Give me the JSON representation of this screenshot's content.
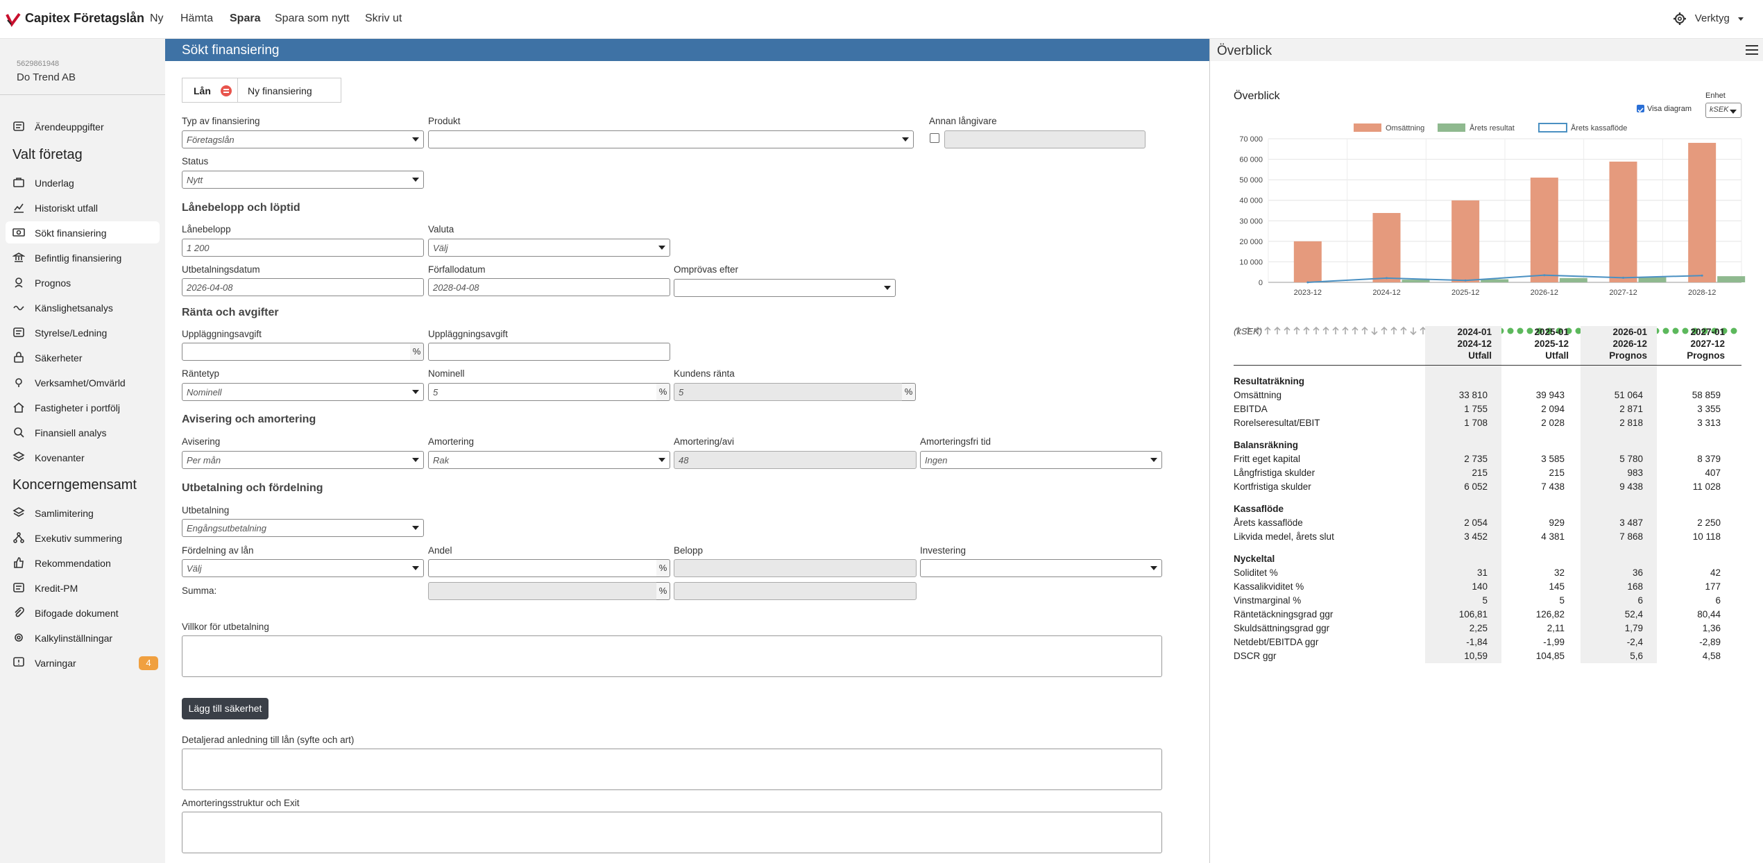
{
  "topbar": {
    "brand": "Capitex Företagslån",
    "nav": [
      "Ny",
      "Hämta",
      "Spara",
      "Spara som nytt",
      "Skriv ut"
    ],
    "tools": "Verktyg"
  },
  "sidebar": {
    "orgnr": "5629861948",
    "company": "Do Trend AB",
    "top_item": "Ärendeuppgifter",
    "section1": "Valt företag",
    "section1_items": [
      "Underlag",
      "Historiskt utfall",
      "Sökt finansiering",
      "Befintlig finansiering",
      "Prognos",
      "Känslighetsanalys",
      "Styrelse/Ledning",
      "Säkerheter",
      "Verksamhet/Omvärld",
      "Fastigheter i portfölj",
      "Finansiell analys",
      "Kovenanter"
    ],
    "section2": "Koncerngemensamt",
    "section2_items": [
      "Samlimitering",
      "Exekutiv summering",
      "Rekommendation",
      "Kredit-PM",
      "Bifogade dokument",
      "Kalkylinställningar",
      "Varningar"
    ],
    "warnings_count": "4"
  },
  "main": {
    "title": "Sökt finansiering",
    "tabs": [
      "Lån",
      "Ny finansiering"
    ],
    "labels": {
      "typ": "Typ av finansiering",
      "produkt": "Produkt",
      "annan": "Annan långivare",
      "status": "Status",
      "sec_belopp": "Lånebelopp och löptid",
      "lanebelopp": "Lånebelopp",
      "valuta": "Valuta",
      "utbetalningsdatum": "Utbetalningsdatum",
      "forfallodatum": "Förfallodatum",
      "omprovas": "Omprövas efter",
      "sec_ranta": "Ränta och avgifter",
      "upplagg1": "Uppläggningsavgift",
      "upplagg2": "Uppläggningsavgift",
      "rantetyp": "Räntetyp",
      "nominell": "Nominell",
      "kundens": "Kundens ränta",
      "sec_avisering": "Avisering och amortering",
      "avisering": "Avisering",
      "amortering": "Amortering",
      "amort_avi": "Amortering/avi",
      "amortfri": "Amorteringsfri tid",
      "sec_utbet": "Utbetalning och fördelning",
      "utbetalning": "Utbetalning",
      "fordelning": "Fördelning av lån",
      "andel": "Andel",
      "belopp": "Belopp",
      "investering": "Investering",
      "summa": "Summa:",
      "villkor": "Villkor för utbetalning",
      "detalj": "Detaljerad anledning till lån (syfte och art)",
      "amortstruktur": "Amorteringsstruktur och Exit"
    },
    "values": {
      "typ": "Företagslån",
      "produkt": "",
      "annan": "",
      "status": "Nytt",
      "lanebelopp": "1 200",
      "valuta": "Välj",
      "utbetalningsdatum": "2026-04-08",
      "forfallodatum": "2028-04-08",
      "omprovas": "",
      "upplagg1": "",
      "upplagg2": "",
      "rantetyp": "Nominell",
      "nominell": "5",
      "kundens": "5",
      "avisering": "Per mån",
      "amortering": "Rak",
      "amort_avi": "48",
      "amortfri": "Ingen",
      "utbetalning": "Engångsutbetalning",
      "fordelning": "Välj",
      "andel": "",
      "belopp": "",
      "investering": ""
    },
    "pct": "%",
    "add_button": "Lägg till säkerhet"
  },
  "overview": {
    "title": "Överblick",
    "subtitle": "Överblick",
    "visa_diagram": "Visa diagram",
    "enhet_label": "Enhet",
    "enhet_value": "kSEK",
    "unit": "(kSEK)",
    "columns": [
      {
        "l1": "2024-01",
        "l2": "2024-12",
        "l3": "Utfall"
      },
      {
        "l1": "2025-01",
        "l2": "2025-12",
        "l3": "Utfall"
      },
      {
        "l1": "2026-01",
        "l2": "2026-12",
        "l3": "Prognos"
      },
      {
        "l1": "2027-01",
        "l2": "2027-12",
        "l3": "Prognos"
      }
    ],
    "sections": [
      {
        "title": "Resultaträkning",
        "rows": [
          {
            "label": "Omsättning",
            "v": [
              "33 810",
              "39 943",
              "51 064",
              "58 859"
            ],
            "m": [
              "",
              "up",
              "up",
              "up"
            ]
          },
          {
            "label": "EBITDA",
            "v": [
              "1 755",
              "2 094",
              "2 871",
              "3 355"
            ],
            "m": [
              "",
              "up",
              "up",
              "up"
            ]
          },
          {
            "label": "Rorelseresultat/EBIT",
            "v": [
              "1 708",
              "2 028",
              "2 818",
              "3 313"
            ],
            "m": [
              "",
              "up",
              "up",
              "up"
            ]
          }
        ]
      },
      {
        "title": "Balansräkning",
        "rows": [
          {
            "label": "Fritt eget kapital",
            "v": [
              "2 735",
              "3 585",
              "5 780",
              "8 379"
            ],
            "m": [
              "",
              "up",
              "up",
              "up"
            ]
          },
          {
            "label": "Långfristiga skulder",
            "v": [
              "215",
              "215",
              "983",
              "407"
            ],
            "m": [
              "",
              "up",
              "up",
              "down"
            ]
          },
          {
            "label": "Kortfristiga skulder",
            "v": [
              "6 052",
              "7 438",
              "9 438",
              "11 028"
            ],
            "m": [
              "",
              "up",
              "up",
              "up"
            ]
          }
        ]
      },
      {
        "title": "Kassaflöde",
        "rows": [
          {
            "label": "Årets kassaflöde",
            "v": [
              "2 054",
              "929",
              "3 487",
              "2 250"
            ],
            "m": [
              "",
              "down",
              "up",
              "down"
            ]
          },
          {
            "label": "Likvida medel, årets slut",
            "v": [
              "3 452",
              "4 381",
              "7 868",
              "10 118"
            ],
            "m": [
              "",
              "up",
              "up",
              "up"
            ]
          }
        ]
      },
      {
        "title": "Nyckeltal",
        "rows": [
          {
            "label": "Soliditet %",
            "v": [
              "31",
              "32",
              "36",
              "42"
            ],
            "m": [
              "dot",
              "dot",
              "dot",
              "dot"
            ]
          },
          {
            "label": "Kassalikviditet %",
            "v": [
              "140",
              "145",
              "168",
              "177"
            ],
            "m": [
              "dot",
              "dot",
              "dot",
              "dot"
            ]
          },
          {
            "label": "Vinstmarginal %",
            "v": [
              "5",
              "5",
              "6",
              "6"
            ],
            "m": [
              "dot",
              "dot",
              "dot",
              "dot"
            ]
          },
          {
            "label": "Räntetäckningsgrad ggr",
            "v": [
              "106,81",
              "126,82",
              "52,4",
              "80,44"
            ],
            "m": [
              "dot",
              "dot",
              "dot",
              "dot"
            ]
          },
          {
            "label": "Skuldsättningsgrad ggr",
            "v": [
              "2,25",
              "2,11",
              "1,79",
              "1,36"
            ],
            "m": [
              "dot",
              "dot",
              "dot",
              "dot"
            ]
          },
          {
            "label": "Netdebt/EBITDA ggr",
            "v": [
              "-1,84",
              "-1,99",
              "-2,4",
              "-2,89"
            ],
            "m": [
              "dot",
              "dot",
              "dot",
              "dot"
            ]
          },
          {
            "label": "DSCR ggr",
            "v": [
              "10,59",
              "104,85",
              "5,6",
              "4,58"
            ],
            "m": [
              "dot",
              "dot",
              "dot",
              "dot"
            ]
          }
        ]
      }
    ],
    "colors": {
      "bar": "#e59a7d",
      "result": "#8fb98f",
      "line": "#4a90c2",
      "dot": "#5cb85c",
      "arrow": "#aaaaaa"
    }
  },
  "chart_data": {
    "type": "bar",
    "categories": [
      "2023-12",
      "2024-12",
      "2025-12",
      "2026-12",
      "2027-12",
      "2028-12"
    ],
    "series": [
      {
        "name": "Omsättning",
        "values": [
          20000,
          33810,
          39943,
          51064,
          58859,
          68000
        ]
      },
      {
        "name": "Årets resultat",
        "values": [
          0,
          1300,
          1500,
          2100,
          2500,
          3000
        ]
      },
      {
        "name": "Årets kassaflöde",
        "values": [
          0,
          2054,
          929,
          3487,
          2250,
          3300
        ]
      }
    ],
    "yticks": [
      "0",
      "10 000",
      "20 000",
      "30 000",
      "40 000",
      "50 000",
      "60 000",
      "70 000"
    ],
    "ylim": [
      0,
      70000
    ],
    "legend": "top"
  }
}
